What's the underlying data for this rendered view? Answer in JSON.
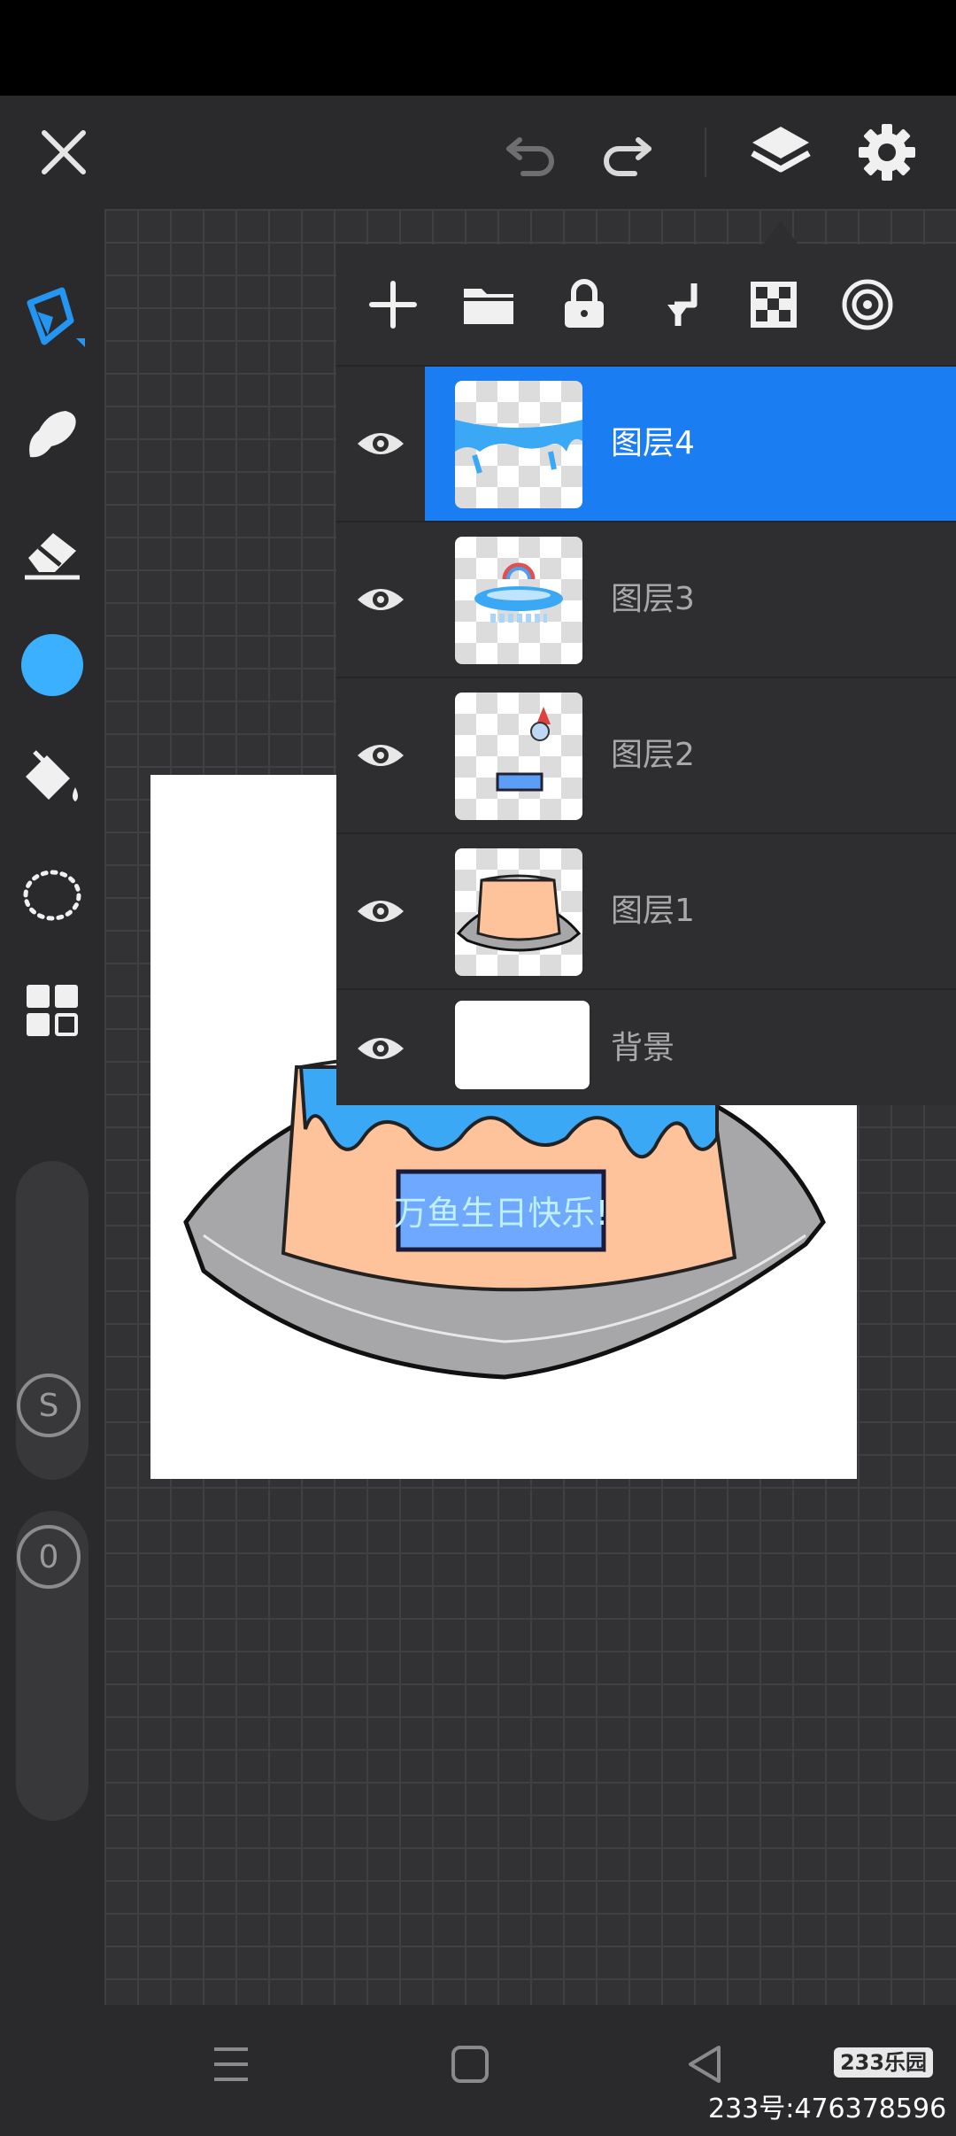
{
  "layers_panel": {
    "toolbar_icons": [
      "add-icon",
      "folder-icon",
      "lock-icon",
      "merge-down-icon",
      "transparency-icon",
      "blend-icon"
    ],
    "layers": [
      {
        "name": "图层4",
        "active": true
      },
      {
        "name": "图层3",
        "active": false
      },
      {
        "name": "图层2",
        "active": false
      },
      {
        "name": "图层1",
        "active": false
      },
      {
        "name": "背景",
        "active": false
      }
    ]
  },
  "left_toolbar": {
    "brush_slider_value": "S",
    "opacity_slider_value": "0",
    "color": "#3ab0ff"
  },
  "artwork": {
    "banner_text": "万鱼生日快乐!"
  },
  "watermark": {
    "logo": "233乐园",
    "text": "233号:476378596"
  },
  "colors": {
    "accent": "#1b7df2",
    "brush_color": "#3ab0ff"
  }
}
